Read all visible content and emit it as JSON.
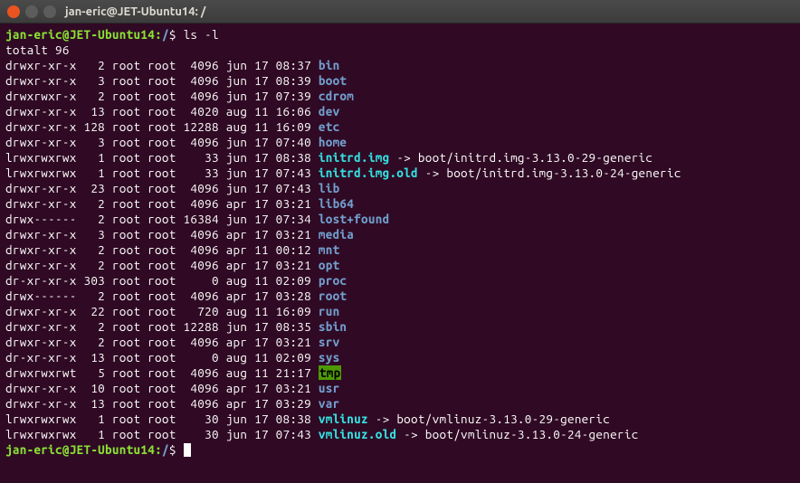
{
  "window": {
    "title": "jan-eric@JET-Ubuntu14: /"
  },
  "prompt": {
    "user_host": "jan-eric@JET-Ubuntu14",
    "path": "/",
    "symbol": "$"
  },
  "command": "ls -l",
  "total_line": "totalt 96",
  "rows": [
    {
      "perm": "drwxr-xr-x",
      "links": "2",
      "owner": "root",
      "group": "root",
      "size": "4096",
      "mon": "jun",
      "day": "17",
      "time": "08:37",
      "name": "bin",
      "type": "dir"
    },
    {
      "perm": "drwxr-xr-x",
      "links": "3",
      "owner": "root",
      "group": "root",
      "size": "4096",
      "mon": "jun",
      "day": "17",
      "time": "08:39",
      "name": "boot",
      "type": "dir"
    },
    {
      "perm": "drwxrwxr-x",
      "links": "2",
      "owner": "root",
      "group": "root",
      "size": "4096",
      "mon": "jun",
      "day": "17",
      "time": "07:39",
      "name": "cdrom",
      "type": "dir"
    },
    {
      "perm": "drwxr-xr-x",
      "links": "13",
      "owner": "root",
      "group": "root",
      "size": "4020",
      "mon": "aug",
      "day": "11",
      "time": "16:06",
      "name": "dev",
      "type": "dir"
    },
    {
      "perm": "drwxr-xr-x",
      "links": "128",
      "owner": "root",
      "group": "root",
      "size": "12288",
      "mon": "aug",
      "day": "11",
      "time": "16:09",
      "name": "etc",
      "type": "dir"
    },
    {
      "perm": "drwxr-xr-x",
      "links": "3",
      "owner": "root",
      "group": "root",
      "size": "4096",
      "mon": "jun",
      "day": "17",
      "time": "07:40",
      "name": "home",
      "type": "dir"
    },
    {
      "perm": "lrwxrwxrwx",
      "links": "1",
      "owner": "root",
      "group": "root",
      "size": "33",
      "mon": "jun",
      "day": "17",
      "time": "08:38",
      "name": "initrd.img",
      "type": "link",
      "target": "boot/initrd.img-3.13.0-29-generic"
    },
    {
      "perm": "lrwxrwxrwx",
      "links": "1",
      "owner": "root",
      "group": "root",
      "size": "33",
      "mon": "jun",
      "day": "17",
      "time": "07:43",
      "name": "initrd.img.old",
      "type": "link",
      "target": "boot/initrd.img-3.13.0-24-generic"
    },
    {
      "perm": "drwxr-xr-x",
      "links": "23",
      "owner": "root",
      "group": "root",
      "size": "4096",
      "mon": "jun",
      "day": "17",
      "time": "07:43",
      "name": "lib",
      "type": "dir"
    },
    {
      "perm": "drwxr-xr-x",
      "links": "2",
      "owner": "root",
      "group": "root",
      "size": "4096",
      "mon": "apr",
      "day": "17",
      "time": "03:21",
      "name": "lib64",
      "type": "dir"
    },
    {
      "perm": "drwx------",
      "links": "2",
      "owner": "root",
      "group": "root",
      "size": "16384",
      "mon": "jun",
      "day": "17",
      "time": "07:34",
      "name": "lost+found",
      "type": "dir"
    },
    {
      "perm": "drwxr-xr-x",
      "links": "3",
      "owner": "root",
      "group": "root",
      "size": "4096",
      "mon": "apr",
      "day": "17",
      "time": "03:21",
      "name": "media",
      "type": "dir"
    },
    {
      "perm": "drwxr-xr-x",
      "links": "2",
      "owner": "root",
      "group": "root",
      "size": "4096",
      "mon": "apr",
      "day": "11",
      "time": "00:12",
      "name": "mnt",
      "type": "dir"
    },
    {
      "perm": "drwxr-xr-x",
      "links": "2",
      "owner": "root",
      "group": "root",
      "size": "4096",
      "mon": "apr",
      "day": "17",
      "time": "03:21",
      "name": "opt",
      "type": "dir"
    },
    {
      "perm": "dr-xr-xr-x",
      "links": "303",
      "owner": "root",
      "group": "root",
      "size": "0",
      "mon": "aug",
      "day": "11",
      "time": "02:09",
      "name": "proc",
      "type": "dir"
    },
    {
      "perm": "drwx------",
      "links": "2",
      "owner": "root",
      "group": "root",
      "size": "4096",
      "mon": "apr",
      "day": "17",
      "time": "03:28",
      "name": "root",
      "type": "dir"
    },
    {
      "perm": "drwxr-xr-x",
      "links": "22",
      "owner": "root",
      "group": "root",
      "size": "720",
      "mon": "aug",
      "day": "11",
      "time": "16:09",
      "name": "run",
      "type": "dir"
    },
    {
      "perm": "drwxr-xr-x",
      "links": "2",
      "owner": "root",
      "group": "root",
      "size": "12288",
      "mon": "jun",
      "day": "17",
      "time": "08:35",
      "name": "sbin",
      "type": "dir"
    },
    {
      "perm": "drwxr-xr-x",
      "links": "2",
      "owner": "root",
      "group": "root",
      "size": "4096",
      "mon": "apr",
      "day": "17",
      "time": "03:21",
      "name": "srv",
      "type": "dir"
    },
    {
      "perm": "dr-xr-xr-x",
      "links": "13",
      "owner": "root",
      "group": "root",
      "size": "0",
      "mon": "aug",
      "day": "11",
      "time": "02:09",
      "name": "sys",
      "type": "dir"
    },
    {
      "perm": "drwxrwxrwt",
      "links": "5",
      "owner": "root",
      "group": "root",
      "size": "4096",
      "mon": "aug",
      "day": "11",
      "time": "21:17",
      "name": "tmp",
      "type": "sticky"
    },
    {
      "perm": "drwxr-xr-x",
      "links": "10",
      "owner": "root",
      "group": "root",
      "size": "4096",
      "mon": "apr",
      "day": "17",
      "time": "03:21",
      "name": "usr",
      "type": "dir"
    },
    {
      "perm": "drwxr-xr-x",
      "links": "13",
      "owner": "root",
      "group": "root",
      "size": "4096",
      "mon": "apr",
      "day": "17",
      "time": "03:29",
      "name": "var",
      "type": "dir"
    },
    {
      "perm": "lrwxrwxrwx",
      "links": "1",
      "owner": "root",
      "group": "root",
      "size": "30",
      "mon": "jun",
      "day": "17",
      "time": "08:38",
      "name": "vmlinuz",
      "type": "link",
      "target": "boot/vmlinuz-3.13.0-29-generic"
    },
    {
      "perm": "lrwxrwxrwx",
      "links": "1",
      "owner": "root",
      "group": "root",
      "size": "30",
      "mon": "jun",
      "day": "17",
      "time": "07:43",
      "name": "vmlinuz.old",
      "type": "link",
      "target": "boot/vmlinuz-3.13.0-24-generic"
    }
  ]
}
